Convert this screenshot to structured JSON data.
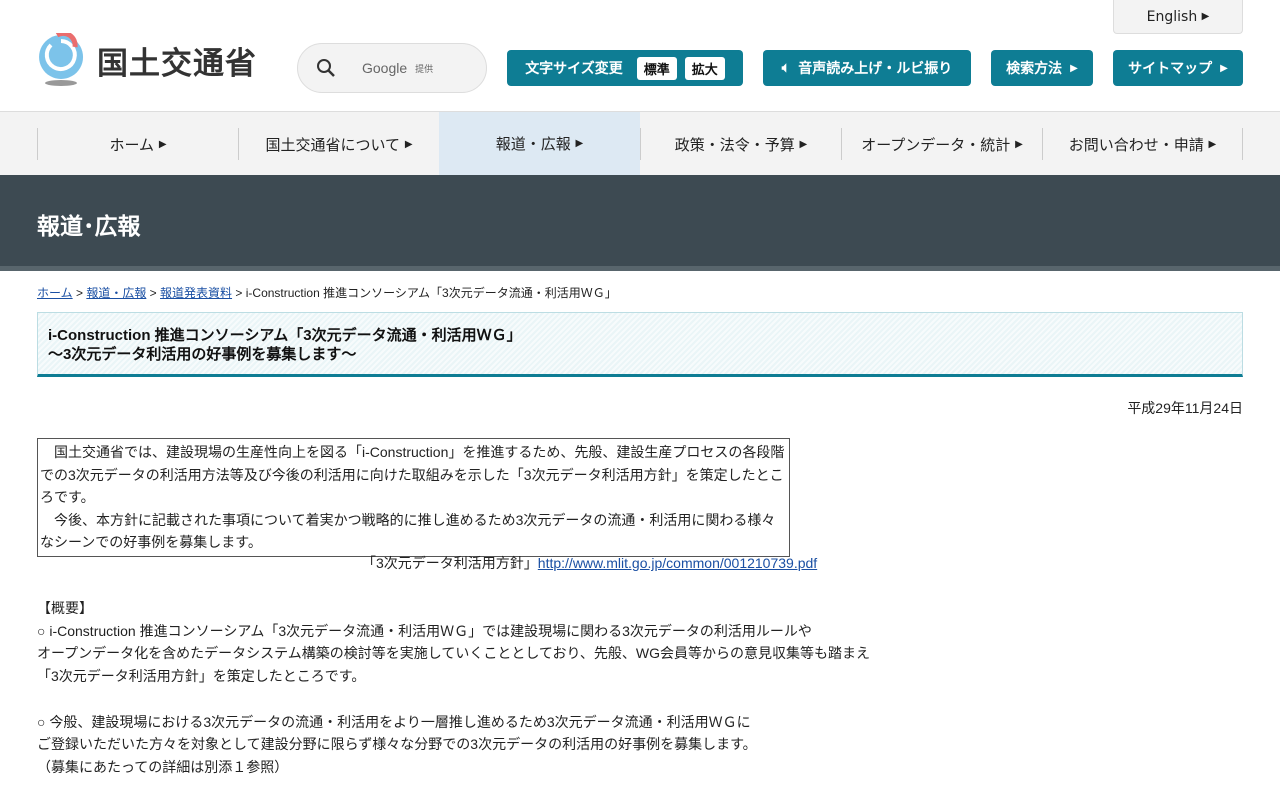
{
  "header": {
    "logo_text": "国土交通省",
    "search_google": "Google",
    "search_provided": "提供",
    "english": "English",
    "font_size_label": "文字サイズ変更",
    "font_standard": "標準",
    "font_large": "拡大",
    "read_aloud": "音声読み上げ・ルビ振り",
    "search_method": "検索方法",
    "sitemap": "サイトマップ"
  },
  "nav": [
    "ホーム",
    "国土交通省について",
    "報道・広報",
    "政策・法令・予算",
    "オープンデータ・統計",
    "お問い合わせ・申請"
  ],
  "banner": {
    "title": "報道･広報"
  },
  "breadcrumb": {
    "home": "ホーム",
    "press": "報道・広報",
    "releases": "報道発表資料",
    "current": "i-Construction 推進コンソーシアム「3次元データ流通・利活用ＷＧ」"
  },
  "article": {
    "title_line1": "i-Construction 推進コンソーシアム「3次元データ流通・利活用ＷＧ」",
    "title_line2": "～3次元データ利活用の好事例を募集します～",
    "date": "平成29年11月24日",
    "intro1": "　国土交通省では、建設現場の生産性向上を図る「i-Construction」を推進するため、先般、建設生産プロセスの各段階での3次元データの利活用方法等及び今後の利活用に向けた取組みを示した「3次元データ利活用方針」を策定したところです。",
    "intro2": "　今後、本方針に記載された事項について着実かつ戦略的に推し進めるため3次元データの流通・利活用に関わる様々なシーンでの好事例を募集します。",
    "policy_label": "「3次元データ利活用方針」",
    "policy_url": "http://www.mlit.go.jp/common/001210739.pdf",
    "overview_heading": "【概要】",
    "p1_l1": "○ i-Construction 推進コンソーシアム「3次元データ流通・利活用ＷＧ」では建設現場に関わる3次元データの利活用ルールや",
    "p1_l2": "オープンデータ化を含めたデータシステム構築の検討等を実施していくこととしており、先般、WG会員等からの意見収集等も踏まえ",
    "p1_l3": "「3次元データ利活用方針」を策定したところです。",
    "p2_l1": "○ 今般、建設現場における3次元データの流通・利活用をより一層推し進めるため3次元データ流通・利活用ＷＧに",
    "p2_l2": "ご登録いただいた方々を対象として建設分野に限らず様々な分野での3次元データの利活用の好事例を募集します。",
    "p2_l3": "（募集にあたっての詳細は別添１参照）"
  }
}
